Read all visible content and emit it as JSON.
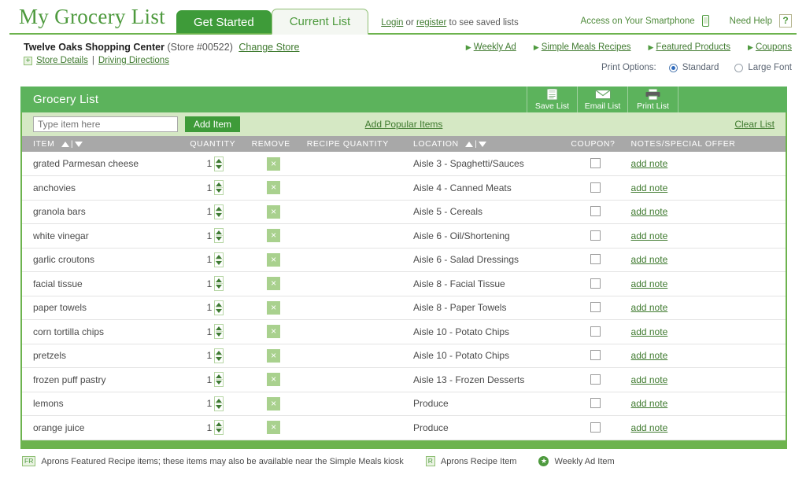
{
  "header": {
    "logo": "My Grocery List",
    "tabs": [
      {
        "label": "Get Started",
        "state": "inactive-solid"
      },
      {
        "label": "Current List",
        "state": "active"
      }
    ],
    "login_text": {
      "login": "Login",
      "or": " or ",
      "register": "register",
      "suffix": " to see saved lists"
    },
    "smartphone_label": "Access on Your Smartphone",
    "smartphone_icon": "smartphone-icon",
    "help_label": "Need Help",
    "help_icon": "question-mark-icon"
  },
  "store": {
    "name": "Twelve Oaks Shopping Center",
    "number": "(Store #00522)",
    "change_store": "Change Store",
    "expand_icon": "plus-icon",
    "details": "Store Details",
    "divider": "|",
    "directions": "Driving Directions"
  },
  "navlinks": [
    {
      "label": "Weekly Ad"
    },
    {
      "label": "Simple Meals Recipes"
    },
    {
      "label": "Featured Products"
    },
    {
      "label": "Coupons"
    }
  ],
  "print_options": {
    "label": "Print Options:",
    "standard": "Standard",
    "large_font": "Large Font",
    "selected": "Standard"
  },
  "panel": {
    "title": "Grocery List",
    "tools": [
      {
        "label": "Save List",
        "icon": "save-disk-icon"
      },
      {
        "label": "Email List",
        "icon": "envelope-icon"
      },
      {
        "label": "Print List",
        "icon": "printer-icon"
      }
    ],
    "add_placeholder": "Type item here",
    "add_value": "",
    "add_button": "Add Item",
    "popular_link": "Add Popular Items",
    "clear_link": "Clear List"
  },
  "table": {
    "columns": [
      {
        "key": "item",
        "label": "ITEM",
        "sortable": true
      },
      {
        "key": "quantity",
        "label": "QUANTITY",
        "sortable": false
      },
      {
        "key": "remove",
        "label": "REMOVE",
        "sortable": false
      },
      {
        "key": "recipe_quantity",
        "label": "RECIPE QUANTITY",
        "sortable": false
      },
      {
        "key": "location",
        "label": "LOCATION",
        "sortable": true
      },
      {
        "key": "coupon",
        "label": "COUPON?",
        "sortable": false
      },
      {
        "key": "notes",
        "label": "NOTES/SPECIAL OFFER",
        "sortable": false
      }
    ],
    "note_label": "add note",
    "remove_glyph": "×",
    "rows": [
      {
        "item": "grated Parmesan cheese",
        "quantity": "1",
        "recipe_quantity": "",
        "location": "Aisle 3 - Spaghetti/Sauces",
        "coupon": false
      },
      {
        "item": "anchovies",
        "quantity": "1",
        "recipe_quantity": "",
        "location": "Aisle 4 - Canned Meats",
        "coupon": false
      },
      {
        "item": "granola bars",
        "quantity": "1",
        "recipe_quantity": "",
        "location": "Aisle 5 - Cereals",
        "coupon": false
      },
      {
        "item": "white vinegar",
        "quantity": "1",
        "recipe_quantity": "",
        "location": "Aisle 6 - Oil/Shortening",
        "coupon": false
      },
      {
        "item": "garlic croutons",
        "quantity": "1",
        "recipe_quantity": "",
        "location": "Aisle 6 - Salad Dressings",
        "coupon": false
      },
      {
        "item": "facial tissue",
        "quantity": "1",
        "recipe_quantity": "",
        "location": "Aisle 8 - Facial Tissue",
        "coupon": false
      },
      {
        "item": "paper towels",
        "quantity": "1",
        "recipe_quantity": "",
        "location": "Aisle 8 - Paper Towels",
        "coupon": false
      },
      {
        "item": "corn tortilla chips",
        "quantity": "1",
        "recipe_quantity": "",
        "location": "Aisle 10 - Potato Chips",
        "coupon": false
      },
      {
        "item": "pretzels",
        "quantity": "1",
        "recipe_quantity": "",
        "location": "Aisle 10 - Potato Chips",
        "coupon": false
      },
      {
        "item": "frozen puff pastry",
        "quantity": "1",
        "recipe_quantity": "",
        "location": "Aisle 13 - Frozen Desserts",
        "coupon": false
      },
      {
        "item": "lemons",
        "quantity": "1",
        "recipe_quantity": "",
        "location": "Produce",
        "coupon": false
      },
      {
        "item": "orange juice",
        "quantity": "1",
        "recipe_quantity": "",
        "location": "Produce",
        "coupon": false
      }
    ]
  },
  "legend": {
    "fr_badge": "FR",
    "fr_text": "Aprons Featured Recipe items; these items may also be available near the Simple Meals kiosk",
    "r_badge": "R",
    "r_text": "Aprons Recipe Item",
    "wa_badge": "★",
    "wa_text": "Weekly Ad Item"
  },
  "colors": {
    "brand_green": "#4e9a3e",
    "panel_green": "#5cb35c",
    "rule_green": "#6db34e",
    "subbar_green": "#d5e8c4",
    "header_gray": "#a8a8a8",
    "link_green": "#3f7a2f",
    "radio_blue": "#2f6bbd"
  }
}
